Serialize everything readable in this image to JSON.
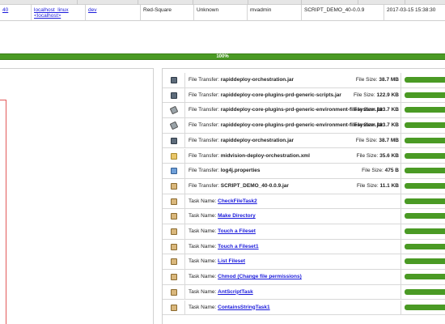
{
  "info_row": {
    "id_link": "40",
    "target_link_1": "localhost_linux",
    "target_link_2": "<localhost>",
    "environment_link": "dev",
    "status": "Red-Square",
    "state": "Unknown",
    "user": "mvadmin",
    "package": "SCRIPT_DEMO_40-0.0.9",
    "timestamp": "2017-03-15 15:38:30"
  },
  "overall_progress": {
    "label": "100%",
    "percent": 100
  },
  "tasks": [
    {
      "type": "file",
      "icon": "jar-icon",
      "prefix": "File Transfer: ",
      "name": "rapiddeploy-orchestration.jar",
      "size_label": "File Size: ",
      "size": "38.7 MB",
      "progress": 100
    },
    {
      "type": "file",
      "icon": "jar-icon",
      "prefix": "File Transfer: ",
      "name": "rapiddeploy-core-plugins-prd-generic-scripts.jar",
      "size_label": "File Size: ",
      "size": "122.9 KB",
      "progress": 100
    },
    {
      "type": "file",
      "icon": "archive-icon",
      "prefix": "File Transfer: ",
      "name": "rapiddeploy-core-plugins-prd-generic-environment-filesystem.jar",
      "size_label": "File Size: ",
      "size": "113.7 KB",
      "progress": 100
    },
    {
      "type": "file",
      "icon": "archive-icon",
      "prefix": "File Transfer: ",
      "name": "rapiddeploy-core-plugins-prd-generic-environment-filesystem.jar",
      "size_label": "File Size: ",
      "size": "113.7 KB",
      "progress": 100
    },
    {
      "type": "file",
      "icon": "jar-icon",
      "prefix": "File Transfer: ",
      "name": "rapiddeploy-orchestration.jar",
      "size_label": "File Size: ",
      "size": "38.7 MB",
      "progress": 100
    },
    {
      "type": "file",
      "icon": "xml-file-icon",
      "prefix": "File Transfer: ",
      "name": "midvision-deploy-orchestration.xml",
      "size_label": "File Size: ",
      "size": "35.6 KB",
      "progress": 100
    },
    {
      "type": "file",
      "icon": "properties-file-icon",
      "prefix": "File Transfer: ",
      "name": "log4j.properties",
      "size_label": "File Size: ",
      "size": "475 B",
      "progress": 100
    },
    {
      "type": "file",
      "icon": "package-icon",
      "prefix": "File Transfer: ",
      "name": "SCRIPT_DEMO_40-0.0.9.jar",
      "size_label": "File Size: ",
      "size": "11.1 KB",
      "progress": 100
    },
    {
      "type": "task",
      "icon": "clipboard-icon",
      "prefix": "Task Name: ",
      "name": "CheckFileTask2",
      "progress": 100
    },
    {
      "type": "task",
      "icon": "clipboard-icon",
      "prefix": "Task Name: ",
      "name": "Make Directory",
      "progress": 100
    },
    {
      "type": "task",
      "icon": "clipboard-icon",
      "prefix": "Task Name: ",
      "name": "Touch a Fileset",
      "progress": 100
    },
    {
      "type": "task",
      "icon": "clipboard-icon",
      "prefix": "Task Name: ",
      "name": "Touch a Fileset1",
      "progress": 100
    },
    {
      "type": "task",
      "icon": "clipboard-icon",
      "prefix": "Task Name: ",
      "name": "List Fileset",
      "progress": 100
    },
    {
      "type": "task",
      "icon": "clipboard-icon",
      "prefix": "Task Name: ",
      "name": "Chmod (Change file permissions)",
      "progress": 100
    },
    {
      "type": "task",
      "icon": "clipboard-icon",
      "prefix": "Task Name: ",
      "name": "AntScriptTask",
      "progress": 100
    },
    {
      "type": "task",
      "icon": "clipboard-icon",
      "prefix": "Task Name: ",
      "name": "ContainsStringTask1",
      "progress": 100
    }
  ],
  "colors": {
    "progress_green": "#4a9a24",
    "link_blue": "#1a1adb",
    "left_outline_red": "#e25a5a"
  }
}
